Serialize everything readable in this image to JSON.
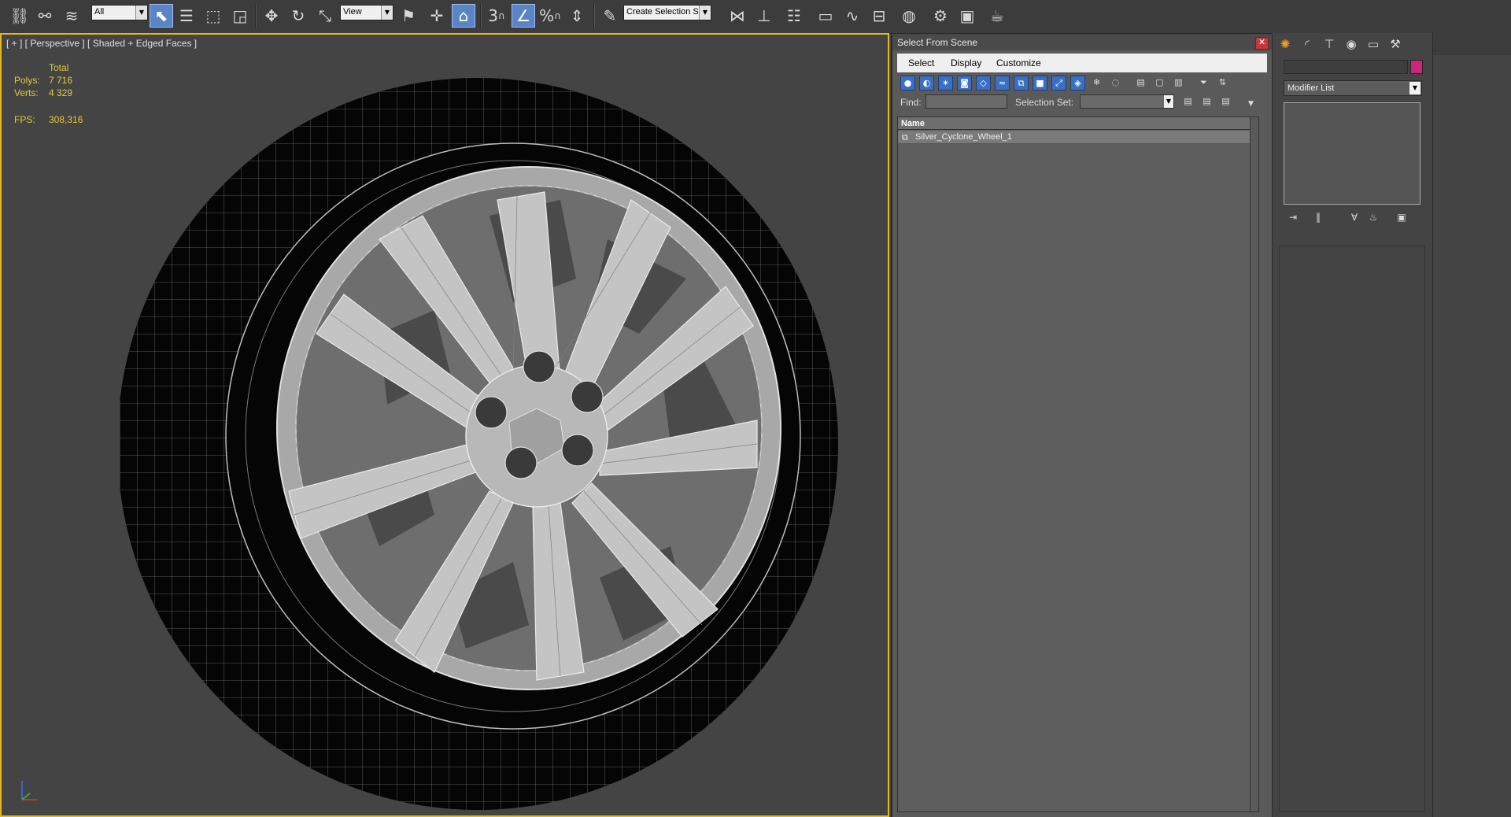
{
  "toolbar": {
    "selection_filter": "All",
    "ref_coord": "View",
    "named_selection": "Create Selection Se",
    "snap_label": "3",
    "percent_snap_label": "%"
  },
  "viewport": {
    "label": "[ + ] [ Perspective ] [ Shaded + Edged Faces ]",
    "stats": {
      "total_header": "Total",
      "polys_label": "Polys:",
      "polys_value": "7 716",
      "verts_label": "Verts:",
      "verts_value": "4 329",
      "fps_label": "FPS:",
      "fps_value": "308,316"
    },
    "accent_color": "#e1b821"
  },
  "dialog": {
    "title": "Select From Scene",
    "menu": [
      "Select",
      "Display",
      "Customize"
    ],
    "find_label": "Find:",
    "selection_set_label": "Selection Set:",
    "column_header": "Name",
    "items": [
      "Silver_Cyclone_Wheel_1"
    ]
  },
  "command_panel": {
    "modifier_list": "Modifier List",
    "object_color": "#c8277a"
  }
}
